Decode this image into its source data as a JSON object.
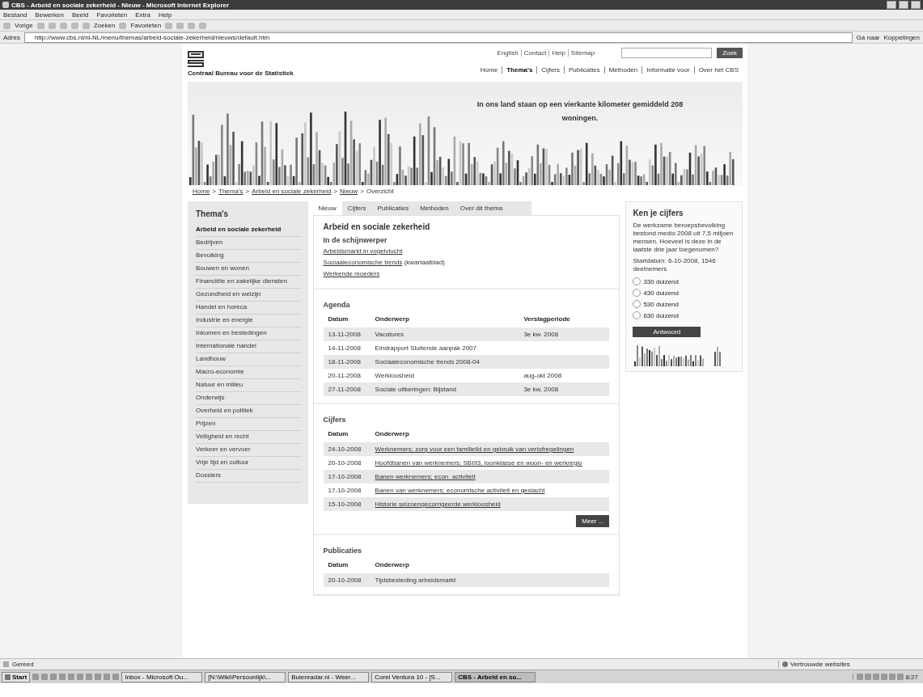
{
  "window": {
    "title": "CBS - Arbeid en sociale zekerheid - Nieuw - Microsoft Internet Explorer"
  },
  "menu": [
    "Bestand",
    "Bewerken",
    "Beeld",
    "Favorieten",
    "Extra",
    "Help"
  ],
  "toolbar": {
    "back": "Vorige",
    "search": "Zoeken",
    "favorites": "Favorieten"
  },
  "address": {
    "label": "Adres",
    "value": "http://www.cbs.nl/nl-NL/menu/themas/arbeid-sociale-zekerheid/nieuws/default.htm",
    "go": "Ga naar",
    "links": "Koppelingen"
  },
  "site": {
    "top_links": [
      "English",
      "Contact",
      "Help",
      "Sitemap"
    ],
    "search_button": "Zoek",
    "logo_text": "Centraal Bureau voor de Statistiek",
    "nav": [
      {
        "label": "Home",
        "selected": false
      },
      {
        "label": "Thema's",
        "selected": true
      },
      {
        "label": "Cijfers",
        "selected": false
      },
      {
        "label": "Publicaties",
        "selected": false
      },
      {
        "label": "Methoden",
        "selected": false
      },
      {
        "label": "Informatie voor",
        "selected": false
      },
      {
        "label": "Over het CBS",
        "selected": false
      }
    ],
    "banner_text": "In ons land staan op een vierkante kilometer gemiddeld 208 woningen.",
    "breadcrumb": [
      {
        "text": "Home",
        "kind": "link"
      },
      {
        "text": ">",
        "kind": "sep"
      },
      {
        "text": "Thema's",
        "kind": "link"
      },
      {
        "text": ">",
        "kind": "sep"
      },
      {
        "text": "Arbeid en sociale zekerheid",
        "kind": "link"
      },
      {
        "text": ">",
        "kind": "sep"
      },
      {
        "text": "Nieuw",
        "kind": "link"
      },
      {
        "text": ">",
        "kind": "sep"
      },
      {
        "text": "Overzicht",
        "kind": "current"
      }
    ]
  },
  "sidebar": {
    "title": "Thema's",
    "items": [
      {
        "label": "Arbeid en sociale zekerheid",
        "selected": true
      },
      {
        "label": "Bedrijven",
        "selected": false
      },
      {
        "label": "Bevolking",
        "selected": false
      },
      {
        "label": "Bouwen en wonen",
        "selected": false
      },
      {
        "label": "Financiële en zakelijke diensten",
        "selected": false
      },
      {
        "label": "Gezondheid en welzijn",
        "selected": false
      },
      {
        "label": "Handel en horeca",
        "selected": false
      },
      {
        "label": "Industrie en energie",
        "selected": false
      },
      {
        "label": "Inkomen en bestedingen",
        "selected": false
      },
      {
        "label": "Internationale handel",
        "selected": false
      },
      {
        "label": "Landbouw",
        "selected": false
      },
      {
        "label": "Macro-economie",
        "selected": false
      },
      {
        "label": "Natuur en milieu",
        "selected": false
      },
      {
        "label": "Onderwijs",
        "selected": false
      },
      {
        "label": "Overheid en politiek",
        "selected": false
      },
      {
        "label": "Prijzen",
        "selected": false
      },
      {
        "label": "Veiligheid en recht",
        "selected": false
      },
      {
        "label": "Verkeer en vervoer",
        "selected": false
      },
      {
        "label": "Vrije tijd en cultuur",
        "selected": false
      },
      {
        "label": "Dossiers",
        "selected": false
      }
    ]
  },
  "tabs": [
    {
      "label": "Nieuw",
      "selected": true
    },
    {
      "label": "Cijfers",
      "selected": false
    },
    {
      "label": "Publicaties",
      "selected": false
    },
    {
      "label": "Methoden",
      "selected": false
    },
    {
      "label": "Over dit thema",
      "selected": false
    }
  ],
  "main": {
    "heading": "Arbeid en sociale zekerheid",
    "spotlight": {
      "heading": "In de schijnwerper",
      "links": [
        {
          "link": "Arbeidsmarkt in vogelvlucht"
        },
        {
          "link": "Sociaaleconomische trends",
          "suffix": "(kwartaalblad)"
        },
        {
          "link": "Werkende moeders"
        }
      ]
    },
    "agenda": {
      "heading": "Agenda",
      "columns": [
        "Datum",
        "Onderwerp",
        "Verslagperiode"
      ],
      "rows": [
        [
          "13-11-2008",
          "Vacatures",
          "3e kw. 2008"
        ],
        [
          "14-11-2008",
          "Eindrapport Sluitende aanpak 2007",
          ""
        ],
        [
          "18-11-2008",
          "Sociaaleconomische trends 2008-04",
          ""
        ],
        [
          "20-11-2008",
          "Werkloosheid",
          "aug-okt 2008"
        ],
        [
          "27-11-2008",
          "Sociale uitkeringen: Bijstand",
          "3e kw. 2008"
        ]
      ]
    },
    "cijfers": {
      "heading": "Cijfers",
      "columns": [
        "Datum",
        "Onderwerp"
      ],
      "rows": [
        [
          "24-10-2008",
          "Werknemers; zorg voor een familielid en gebruik van verlofregelingen"
        ],
        [
          "20-10-2008",
          "Hoofdbanen van werknemers; SBI93, loonklasse en woon- en werkregio"
        ],
        [
          "17-10-2008",
          "Banen werknemers; econ. activiteit"
        ],
        [
          "17-10-2008",
          "Banen van werknemers; economische activiteit en geslacht"
        ],
        [
          "15-10-2008",
          "Historie seizoengecorrigeerde werkloosheid"
        ]
      ],
      "more": "Meer ..."
    },
    "publicaties": {
      "heading": "Publicaties",
      "columns": [
        "Datum",
        "Onderwerp"
      ],
      "rows": [
        [
          "20-10-2008",
          "Tijdsbesteding arbeidsmarkt"
        ]
      ]
    }
  },
  "quiz": {
    "title": "Ken je cijfers",
    "question": "De werkzame beroepsbevolking bestond medio 2008 uit 7,5 miljoen mensen. Hoeveel is deze in de laatste drie jaar toegenomen?",
    "stats": "Startdatum: 6-10-2008, 1546 deelnemers",
    "options": [
      {
        "label": "330 duizend",
        "selected": false
      },
      {
        "label": "430 duizend",
        "selected": false
      },
      {
        "label": "530 duizend",
        "selected": false
      },
      {
        "label": "630 duizend",
        "selected": false
      }
    ],
    "button": "Antwoord"
  },
  "status_bar": {
    "text": "Gereed",
    "zone": "Vertrouwde websites"
  },
  "taskbar": {
    "start": "Start",
    "tasks": [
      {
        "label": "Inbox - Microsoft Ou...",
        "selected": false
      },
      {
        "label": "[N:\\Wiki\\Persoonlijk\\...",
        "selected": false
      },
      {
        "label": "Buienradar.nl - Weer...",
        "selected": false
      },
      {
        "label": "Corel Ventura 10 - [S...",
        "selected": false
      },
      {
        "label": "CBS - Arbeid en so...",
        "selected": true
      }
    ],
    "clock": "8:27"
  }
}
